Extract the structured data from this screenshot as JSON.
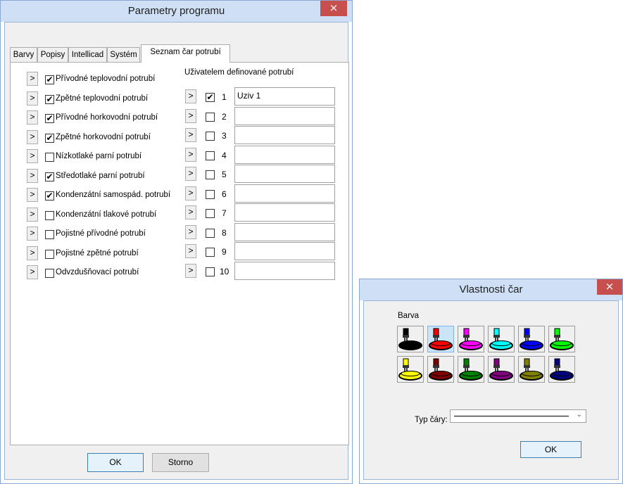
{
  "main_window": {
    "title": "Parametry programu",
    "close_glyph": "×",
    "tabs": [
      {
        "label": "Barvy"
      },
      {
        "label": "Popisy"
      },
      {
        "label": "Intellicad"
      },
      {
        "label": "Systém"
      },
      {
        "label": "Seznam čar potrubí"
      }
    ],
    "active_tab": "Seznam čar potrubí",
    "arrow_glyph": ">",
    "pipes": [
      {
        "label": "Přívodné teplovodní potrubí",
        "checked": true
      },
      {
        "label": "Zpětné teplovodní potrubí",
        "checked": true
      },
      {
        "label": "Přívodné horkovodní potrubí",
        "checked": true
      },
      {
        "label": "Zpětné horkovodní potrubí",
        "checked": true
      },
      {
        "label": "Nízkotlaké parní potrubí",
        "checked": false
      },
      {
        "label": "Středotlaké parní potrubí",
        "checked": true
      },
      {
        "label": "Kondenzátní samospád. potrubí",
        "checked": true
      },
      {
        "label": "Kondenzátní tlakové potrubí",
        "checked": false
      },
      {
        "label": "Pojistné přívodné potrubí",
        "checked": false
      },
      {
        "label": "Pojistné zpětné potrubí",
        "checked": false
      },
      {
        "label": "Odvzdušňovací potrubí",
        "checked": false
      }
    ],
    "user_section_title": "Uživatelem definované potrubí",
    "user_pipes": [
      {
        "number": "1",
        "checked": true,
        "value": "Uziv 1"
      },
      {
        "number": "2",
        "checked": false,
        "value": ""
      },
      {
        "number": "3",
        "checked": false,
        "value": ""
      },
      {
        "number": "4",
        "checked": false,
        "value": ""
      },
      {
        "number": "5",
        "checked": false,
        "value": ""
      },
      {
        "number": "6",
        "checked": false,
        "value": ""
      },
      {
        "number": "7",
        "checked": false,
        "value": ""
      },
      {
        "number": "8",
        "checked": false,
        "value": ""
      },
      {
        "number": "9",
        "checked": false,
        "value": ""
      },
      {
        "number": "10",
        "checked": false,
        "value": ""
      }
    ],
    "ok_label": "OK",
    "cancel_label": "Storno"
  },
  "line_dialog": {
    "title": "Vlastnosti čar",
    "close_glyph": "×",
    "color_label": "Barva",
    "colors": [
      {
        "name": "black",
        "hex": "#000000",
        "selected": false
      },
      {
        "name": "red",
        "hex": "#ff0000",
        "selected": true
      },
      {
        "name": "magenta",
        "hex": "#ff00ff",
        "selected": false
      },
      {
        "name": "cyan",
        "hex": "#00ffff",
        "selected": false
      },
      {
        "name": "blue",
        "hex": "#0000ff",
        "selected": false
      },
      {
        "name": "green",
        "hex": "#00ff00",
        "selected": false
      },
      {
        "name": "yellow",
        "hex": "#ffff00",
        "selected": false
      },
      {
        "name": "dark-red",
        "hex": "#800000",
        "selected": false
      },
      {
        "name": "dark-green",
        "hex": "#008000",
        "selected": false
      },
      {
        "name": "purple",
        "hex": "#800080",
        "selected": false
      },
      {
        "name": "olive",
        "hex": "#808000",
        "selected": false
      },
      {
        "name": "navy",
        "hex": "#000080",
        "selected": false
      }
    ],
    "line_type_label": "Typ čáry:",
    "ok_label": "OK"
  },
  "colors": {
    "title_bar": "#cfe0f6",
    "close_button": "#c7504e",
    "default_button_border": "#3c7fb1"
  }
}
